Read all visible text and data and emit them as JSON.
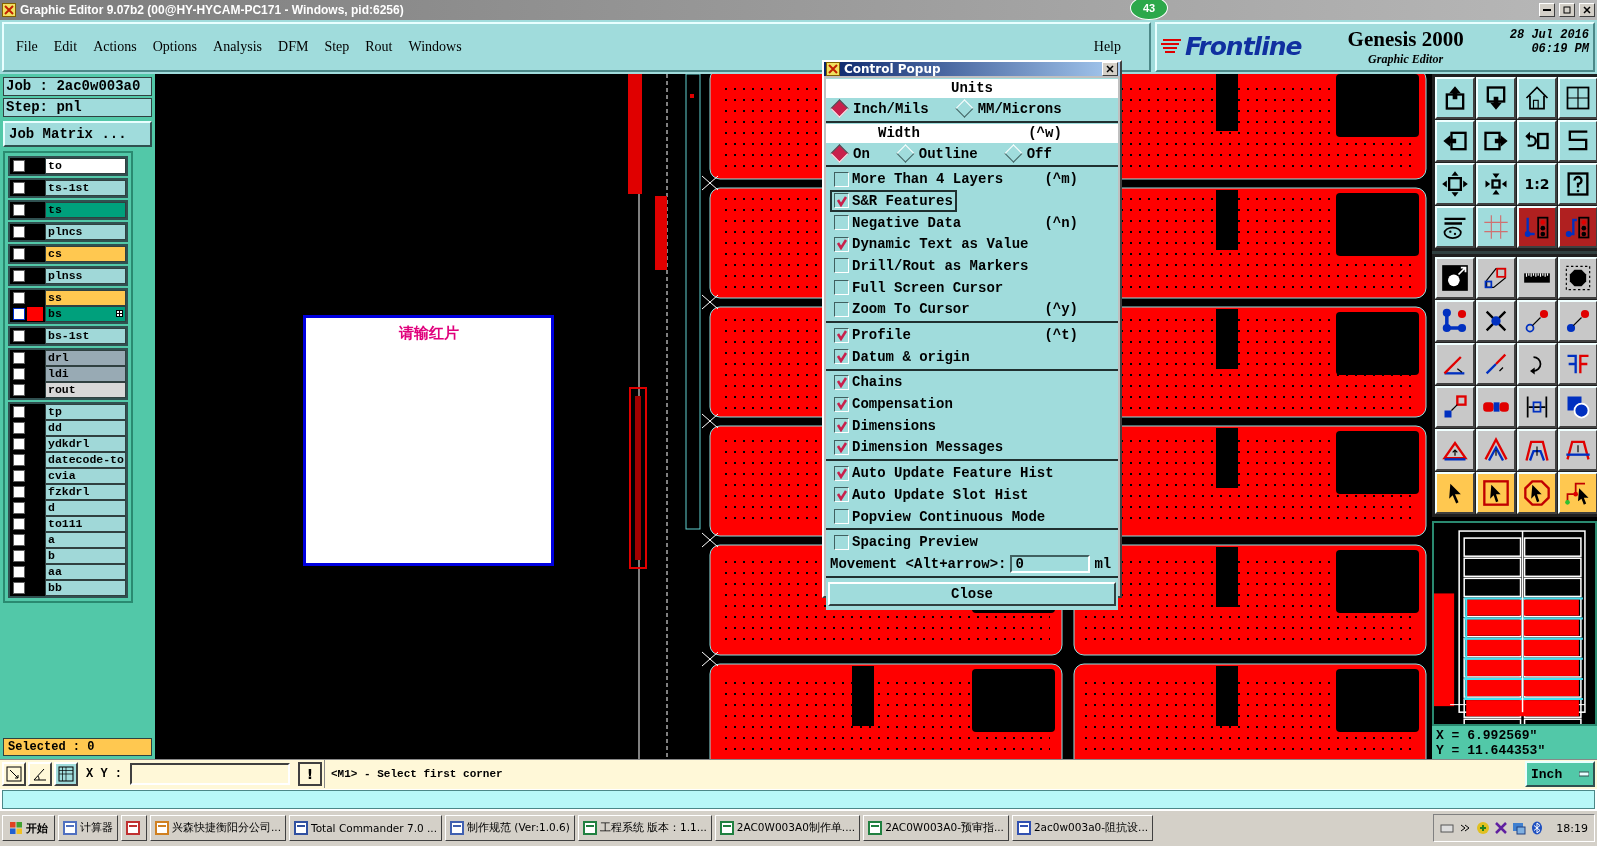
{
  "window": {
    "title": "Graphic Editor 9.07b2 (00@HY-HYCAM-PC171 - Windows, pid:6256)",
    "badge": "43"
  },
  "menu": [
    "File",
    "Edit",
    "Actions",
    "Options",
    "Analysis",
    "DFM",
    "Step",
    "Rout",
    "Windows"
  ],
  "help": "Help",
  "brand": {
    "logo": "Frontline",
    "product": "Genesis 2000",
    "date": "28 Jul 2016",
    "time": "06:19 PM",
    "subtitle": "Graphic Editor"
  },
  "job": {
    "job": "Job : 2ac0w003a0",
    "step": "Step: pnl",
    "matrix_button": "Job Matrix ..."
  },
  "layer_groups": [
    {
      "layers": [
        {
          "name": "to",
          "color": "#ffffff",
          "selected": false,
          "checked": false
        }
      ]
    },
    {
      "layers": [
        {
          "name": "ts-1st",
          "color": "#a0d8d8",
          "selected": false,
          "checked": false
        }
      ]
    },
    {
      "layers": [
        {
          "name": "ts",
          "color": "#00a07c",
          "selected": false,
          "checked": false
        }
      ]
    },
    {
      "layers": [
        {
          "name": "plncs",
          "color": "#a0d8d8",
          "selected": false,
          "checked": false
        }
      ]
    },
    {
      "layers": [
        {
          "name": "cs",
          "color": "#ffc850",
          "selected": false,
          "checked": false
        }
      ]
    },
    {
      "layers": [
        {
          "name": "plnss",
          "color": "#a0d8d8",
          "selected": false,
          "checked": false
        }
      ]
    },
    {
      "layers": [
        {
          "name": "ss",
          "color": "#ffc850",
          "selected": false,
          "checked": false
        },
        {
          "name": "bs",
          "color": "#00a07c",
          "selected": true,
          "checked": false
        }
      ]
    },
    {
      "layers": [
        {
          "name": "bs-1st",
          "color": "#a0d8d8",
          "selected": false,
          "checked": false
        }
      ]
    },
    {
      "layers": [
        {
          "name": "drl",
          "color": "#98aab4",
          "selected": false,
          "checked": false
        },
        {
          "name": "ldi",
          "color": "#98aab4",
          "selected": false,
          "checked": false
        },
        {
          "name": "rout",
          "color": "#d8d8d8",
          "selected": false,
          "checked": false
        }
      ]
    },
    {
      "layers": [
        {
          "name": "tp",
          "color": "#a0d8d8",
          "selected": false,
          "checked": false
        },
        {
          "name": "dd",
          "color": "#a0d8d8",
          "selected": false,
          "checked": false
        },
        {
          "name": "ydkdrl",
          "color": "#a0d8d8",
          "selected": false,
          "checked": false
        },
        {
          "name": "datecode-to",
          "color": "#a0d8d8",
          "selected": false,
          "checked": false
        },
        {
          "name": "cvia",
          "color": "#a0d8d8",
          "selected": false,
          "checked": false
        },
        {
          "name": "fzkdrl",
          "color": "#a0d8d8",
          "selected": false,
          "checked": false
        },
        {
          "name": "d",
          "color": "#a0d8d8",
          "selected": false,
          "checked": false
        },
        {
          "name": "to111",
          "color": "#a0d8d8",
          "selected": false,
          "checked": false
        },
        {
          "name": "a",
          "color": "#a0d8d8",
          "selected": false,
          "checked": false
        },
        {
          "name": "b",
          "color": "#a0d8d8",
          "selected": false,
          "checked": false
        },
        {
          "name": "aa",
          "color": "#a0d8d8",
          "selected": false,
          "checked": false
        },
        {
          "name": "bb",
          "color": "#a0d8d8",
          "selected": false,
          "checked": false
        }
      ]
    }
  ],
  "selected_count": "Selected : 0",
  "canvas": {
    "note": "请输红片"
  },
  "popup": {
    "title": "Control Popup",
    "units": {
      "header": "Units",
      "options": [
        {
          "label": "Inch/Mils",
          "selected": true
        },
        {
          "label": "MM/Microns",
          "selected": false
        }
      ]
    },
    "width": {
      "header": "Width",
      "shortcut": "(^w)",
      "options": [
        {
          "label": "On",
          "selected": true
        },
        {
          "label": "Outline",
          "selected": false
        },
        {
          "label": "Off",
          "selected": false
        }
      ]
    },
    "check_groups": [
      [
        {
          "label": "More Than 4 Layers",
          "shortcut": "(^m)",
          "checked": false,
          "focused": false
        },
        {
          "label": "S&R Features",
          "checked": true,
          "focused": true
        },
        {
          "label": "Negative Data",
          "shortcut": "(^n)",
          "checked": false,
          "focused": false
        },
        {
          "label": "Dynamic Text as Value",
          "checked": true,
          "focused": false
        },
        {
          "label": "Drill/Rout as Markers",
          "checked": false,
          "focused": false
        },
        {
          "label": "Full Screen Cursor",
          "checked": false,
          "focused": false
        },
        {
          "label": "Zoom To Cursor",
          "shortcut": "(^y)",
          "checked": false,
          "focused": false
        }
      ],
      [
        {
          "label": "Profile",
          "shortcut": "(^t)",
          "checked": true,
          "focused": false
        },
        {
          "label": "Datum & origin",
          "checked": true,
          "focused": false
        }
      ],
      [
        {
          "label": "Chains",
          "checked": true,
          "focused": false
        },
        {
          "label": "Compensation",
          "checked": true,
          "focused": false
        },
        {
          "label": "Dimensions",
          "checked": true,
          "focused": false
        },
        {
          "label": "Dimension Messages",
          "checked": true,
          "focused": false
        }
      ],
      [
        {
          "label": "Auto Update Feature Hist",
          "checked": true,
          "focused": false
        },
        {
          "label": "Auto Update Slot Hist",
          "checked": true,
          "focused": false
        },
        {
          "label": "Popview Continuous Mode",
          "checked": false,
          "focused": false
        }
      ],
      [
        {
          "label": "Spacing Preview",
          "checked": false,
          "focused": false
        }
      ]
    ],
    "movement": {
      "label": "Movement <Alt+arrow>:",
      "value": "0",
      "unit": "ml"
    },
    "close": "Close"
  },
  "toolbar": {
    "ratio_label": "1:2"
  },
  "coordinates": {
    "x": "X = 6.992569\"",
    "y": "Y = 11.644353\""
  },
  "command_bar": {
    "xy_label": "X Y :",
    "alert": "!",
    "message": "<M1> - Select first corner",
    "units": "Inch"
  },
  "taskbar": {
    "start": "开始",
    "items": [
      {
        "label": "计算器"
      },
      {
        "kind": "icon"
      },
      {
        "label": "兴森快捷衡阳分公司..."
      },
      {
        "label": "Total Commander 7.0 ..."
      },
      {
        "label": "制作规范 (Ver:1.0.6)"
      },
      {
        "label": "工程系统  版本：1.1..."
      },
      {
        "label": "2AC0W003A0制作单...."
      },
      {
        "label": "2AC0W003A0-预审指..."
      },
      {
        "label": "2ac0w003a0-阻抗设..."
      }
    ],
    "clock": "18:19"
  }
}
